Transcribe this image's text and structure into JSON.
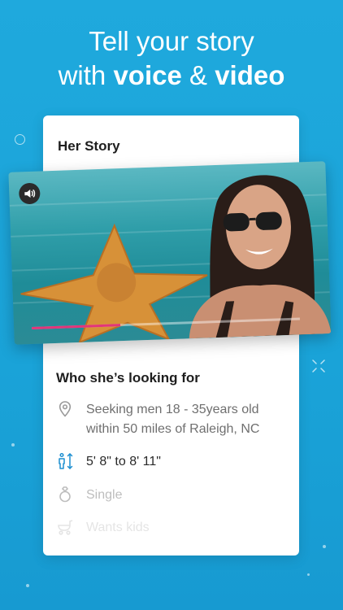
{
  "headline": {
    "line1": "Tell your story",
    "line2_pre": "with ",
    "line2_voice": "voice",
    "line2_amp": " & ",
    "line2_video": "video"
  },
  "card": {
    "title": "Her Story",
    "video": {
      "progress": 0.33,
      "accent_color": "#e3357a"
    },
    "section_title": "Who she’s looking for",
    "details": [
      {
        "icon": "location-pin-icon",
        "text_line1": "Seeking men 18 - 35years old",
        "text_line2": "within 50 miles of Raleigh, NC"
      },
      {
        "icon": "height-icon",
        "text": "5' 8\" to 8' 11\""
      },
      {
        "icon": "ring-icon",
        "text": "Single"
      },
      {
        "icon": "stroller-icon",
        "text": "Wants kids"
      }
    ]
  },
  "colors": {
    "background": "#1fa9dd",
    "icon_blue": "#1d8fd1",
    "text_gray": "#6f6f6f"
  }
}
